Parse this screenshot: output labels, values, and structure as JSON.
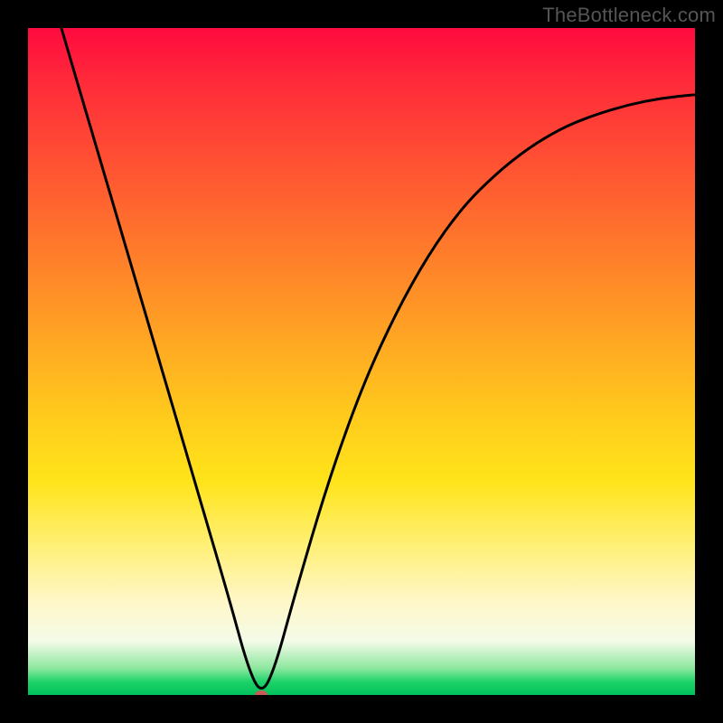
{
  "watermark": "TheBottleneck.com",
  "colors": {
    "frame": "#000000",
    "curve": "#000000",
    "marker": "#cc5a55",
    "gradient_top": "#ff0a3e",
    "gradient_bottom": "#00c05a"
  },
  "chart_data": {
    "type": "line",
    "title": "",
    "xlabel": "",
    "ylabel": "",
    "xlim": [
      0,
      100
    ],
    "ylim": [
      0,
      100
    ],
    "grid": false,
    "legend": false,
    "series": [
      {
        "name": "curve",
        "x": [
          5,
          10,
          15,
          20,
          25,
          30,
          33,
          35,
          37,
          40,
          45,
          50,
          55,
          60,
          65,
          70,
          75,
          80,
          85,
          90,
          95,
          100
        ],
        "y": [
          100,
          83,
          66,
          49,
          32,
          15,
          4,
          0,
          4,
          15,
          32,
          46,
          57,
          66,
          73,
          78,
          82,
          85,
          87,
          88.5,
          89.5,
          90
        ]
      }
    ],
    "annotations": [
      {
        "name": "min-marker",
        "x": 35,
        "y": 0
      }
    ],
    "background_gradient": {
      "stops": [
        {
          "pos": 0.0,
          "color": "#ff0a3e"
        },
        {
          "pos": 0.5,
          "color": "#ffaa22"
        },
        {
          "pos": 0.8,
          "color": "#fff07a"
        },
        {
          "pos": 0.96,
          "color": "#8de79e"
        },
        {
          "pos": 1.0,
          "color": "#00c05a"
        }
      ]
    }
  }
}
